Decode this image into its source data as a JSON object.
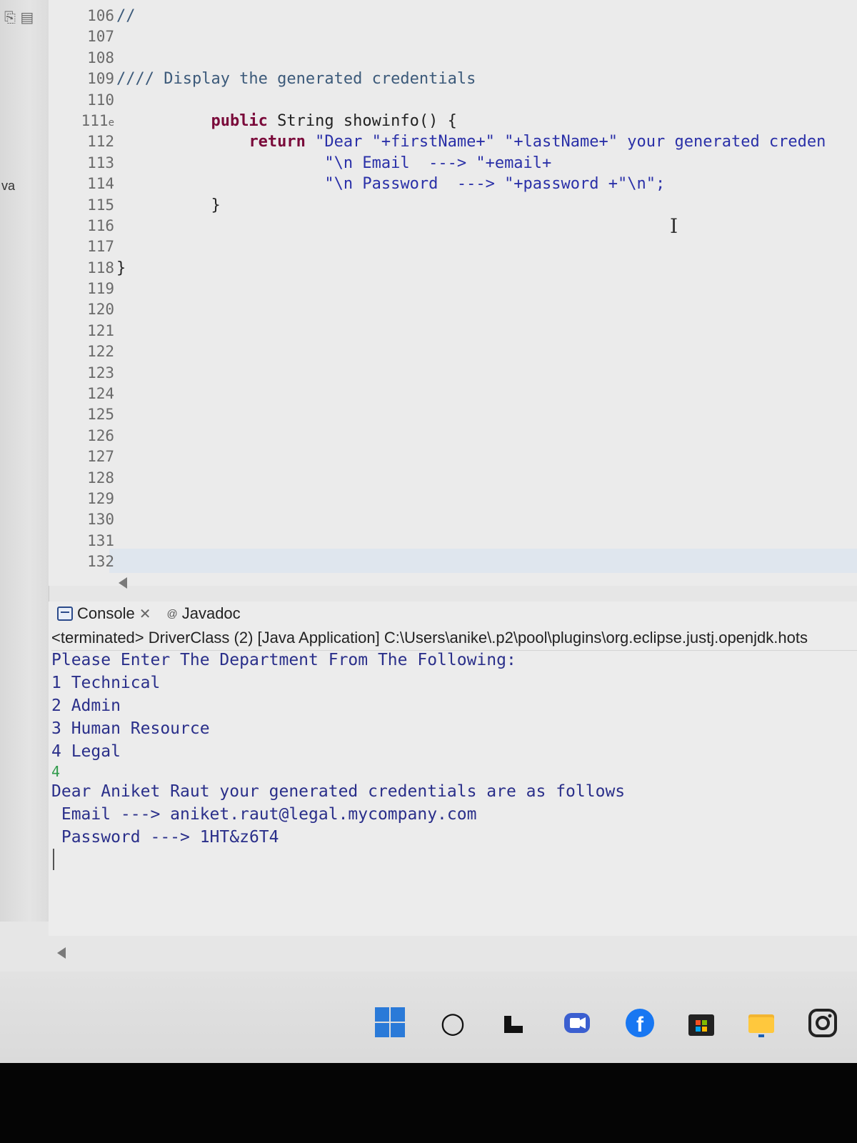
{
  "editor": {
    "line_numbers": [
      "106",
      "107",
      "108",
      "109",
      "110",
      "111",
      "112",
      "113",
      "114",
      "115",
      "116",
      "117",
      "118",
      "119",
      "120",
      "121",
      "122",
      "123",
      "124",
      "125",
      "126",
      "127",
      "128",
      "129",
      "130",
      "131",
      "132"
    ],
    "code": {
      "l106": "//",
      "l109": "//// Display the generated credentials",
      "l111_kw1": "public",
      "l111_rest": " String showinfo() {",
      "l112_kw": "return",
      "l112_str": " \"Dear \"+firstName+\" \"+lastName+\" your generated creden",
      "l113": "\"\\n Email  ---> \"+email+",
      "l114": "\"\\n Password  ---> \"+password +\"\\n\";",
      "l115": "}",
      "l118": "}"
    },
    "left_strip_label": "va",
    "marker_111": "e"
  },
  "console": {
    "tab_console": "Console",
    "tab_javadoc": "Javadoc",
    "status": "<terminated> DriverClass (2) [Java Application] C:\\Users\\anike\\.p2\\pool\\plugins\\org.eclipse.justj.openjdk.hots",
    "lines": [
      "Please Enter The Department From The Following:",
      "1 Technical",
      "2 Admin",
      "3 Human Resource",
      "4 Legal"
    ],
    "user_input": "4",
    "result_lines": [
      "Dear Aniket Raut your generated credentials are as follows",
      " Email ---> aniket.raut@legal.mycompany.com",
      " Password ---> 1HT&z6T4"
    ]
  },
  "taskbar": {
    "icons": [
      "windows-start-icon",
      "search-icon",
      "task-view-icon",
      "teams-icon",
      "facebook-icon",
      "store-icon",
      "file-explorer-icon",
      "instagram-icon"
    ],
    "accent": "#2a7ad8"
  }
}
